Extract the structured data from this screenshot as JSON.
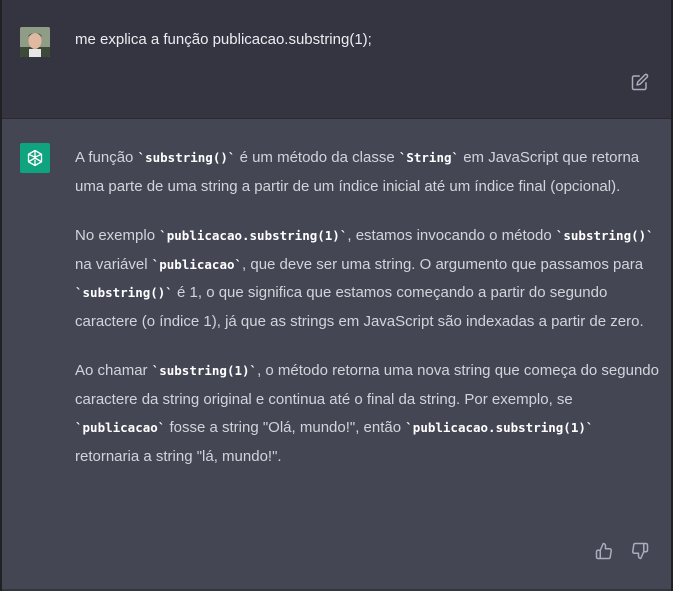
{
  "user_message": {
    "text": "me explica a função publicacao.substring(1);"
  },
  "assistant_message": {
    "p1": {
      "t1": "A função ",
      "c1": "`substring()`",
      "t2": " é um método da classe ",
      "c2": "`String`",
      "t3": " em JavaScript que retorna uma parte de uma string a partir de um índice inicial até um índice final (opcional)."
    },
    "p2": {
      "t1": "No exemplo ",
      "c1": "`publicacao.substring(1)`",
      "t2": ", estamos invocando o método ",
      "c2": "`substring()`",
      "t3": " na variável ",
      "c3": "`publicacao`",
      "t4": ", que deve ser uma string. O argumento que passamos para ",
      "c4": "`substring()`",
      "t5": " é 1, o que significa que estamos começando a partir do segundo caractere (o índice 1), já que as strings em JavaScript são indexadas a partir de zero."
    },
    "p3": {
      "t1": "Ao chamar ",
      "c1": "`substring(1)`",
      "t2": ", o método retorna uma nova string que começa do segundo caractere da string original e continua até o final da string. Por exemplo, se ",
      "c2": "`publicacao`",
      "t3": " fosse a string \"Olá, mundo!\", então ",
      "c3": "`publicacao.substring(1)`",
      "t4": " retornaria a string \"lá, mundo!\"."
    }
  },
  "icons": {
    "user_avatar": "user-avatar-photo",
    "assistant_avatar": "openai-logo-icon",
    "edit": "edit-icon",
    "thumbs_up": "thumbs-up-icon",
    "thumbs_down": "thumbs-down-icon"
  },
  "colors": {
    "background": "#343541",
    "assistant_background": "#444654",
    "assistant_avatar": "#10a37f",
    "text": "#d1d5db"
  }
}
